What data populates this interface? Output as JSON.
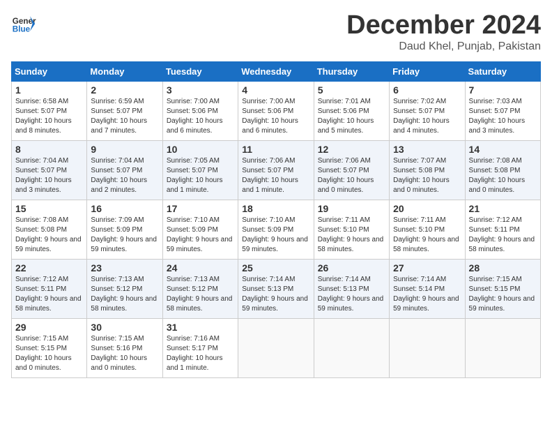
{
  "header": {
    "logo_line1": "General",
    "logo_line2": "Blue",
    "month": "December 2024",
    "location": "Daud Khel, Punjab, Pakistan"
  },
  "weekdays": [
    "Sunday",
    "Monday",
    "Tuesday",
    "Wednesday",
    "Thursday",
    "Friday",
    "Saturday"
  ],
  "weeks": [
    [
      {
        "day": 1,
        "sunrise": "6:58 AM",
        "sunset": "5:07 PM",
        "daylight": "10 hours and 8 minutes."
      },
      {
        "day": 2,
        "sunrise": "6:59 AM",
        "sunset": "5:07 PM",
        "daylight": "10 hours and 7 minutes."
      },
      {
        "day": 3,
        "sunrise": "7:00 AM",
        "sunset": "5:06 PM",
        "daylight": "10 hours and 6 minutes."
      },
      {
        "day": 4,
        "sunrise": "7:00 AM",
        "sunset": "5:06 PM",
        "daylight": "10 hours and 6 minutes."
      },
      {
        "day": 5,
        "sunrise": "7:01 AM",
        "sunset": "5:06 PM",
        "daylight": "10 hours and 5 minutes."
      },
      {
        "day": 6,
        "sunrise": "7:02 AM",
        "sunset": "5:07 PM",
        "daylight": "10 hours and 4 minutes."
      },
      {
        "day": 7,
        "sunrise": "7:03 AM",
        "sunset": "5:07 PM",
        "daylight": "10 hours and 3 minutes."
      }
    ],
    [
      {
        "day": 8,
        "sunrise": "7:04 AM",
        "sunset": "5:07 PM",
        "daylight": "10 hours and 3 minutes."
      },
      {
        "day": 9,
        "sunrise": "7:04 AM",
        "sunset": "5:07 PM",
        "daylight": "10 hours and 2 minutes."
      },
      {
        "day": 10,
        "sunrise": "7:05 AM",
        "sunset": "5:07 PM",
        "daylight": "10 hours and 1 minute."
      },
      {
        "day": 11,
        "sunrise": "7:06 AM",
        "sunset": "5:07 PM",
        "daylight": "10 hours and 1 minute."
      },
      {
        "day": 12,
        "sunrise": "7:06 AM",
        "sunset": "5:07 PM",
        "daylight": "10 hours and 0 minutes."
      },
      {
        "day": 13,
        "sunrise": "7:07 AM",
        "sunset": "5:08 PM",
        "daylight": "10 hours and 0 minutes."
      },
      {
        "day": 14,
        "sunrise": "7:08 AM",
        "sunset": "5:08 PM",
        "daylight": "10 hours and 0 minutes."
      }
    ],
    [
      {
        "day": 15,
        "sunrise": "7:08 AM",
        "sunset": "5:08 PM",
        "daylight": "9 hours and 59 minutes."
      },
      {
        "day": 16,
        "sunrise": "7:09 AM",
        "sunset": "5:09 PM",
        "daylight": "9 hours and 59 minutes."
      },
      {
        "day": 17,
        "sunrise": "7:10 AM",
        "sunset": "5:09 PM",
        "daylight": "9 hours and 59 minutes."
      },
      {
        "day": 18,
        "sunrise": "7:10 AM",
        "sunset": "5:09 PM",
        "daylight": "9 hours and 59 minutes."
      },
      {
        "day": 19,
        "sunrise": "7:11 AM",
        "sunset": "5:10 PM",
        "daylight": "9 hours and 58 minutes."
      },
      {
        "day": 20,
        "sunrise": "7:11 AM",
        "sunset": "5:10 PM",
        "daylight": "9 hours and 58 minutes."
      },
      {
        "day": 21,
        "sunrise": "7:12 AM",
        "sunset": "5:11 PM",
        "daylight": "9 hours and 58 minutes."
      }
    ],
    [
      {
        "day": 22,
        "sunrise": "7:12 AM",
        "sunset": "5:11 PM",
        "daylight": "9 hours and 58 minutes."
      },
      {
        "day": 23,
        "sunrise": "7:13 AM",
        "sunset": "5:12 PM",
        "daylight": "9 hours and 58 minutes."
      },
      {
        "day": 24,
        "sunrise": "7:13 AM",
        "sunset": "5:12 PM",
        "daylight": "9 hours and 58 minutes."
      },
      {
        "day": 25,
        "sunrise": "7:14 AM",
        "sunset": "5:13 PM",
        "daylight": "9 hours and 59 minutes."
      },
      {
        "day": 26,
        "sunrise": "7:14 AM",
        "sunset": "5:13 PM",
        "daylight": "9 hours and 59 minutes."
      },
      {
        "day": 27,
        "sunrise": "7:14 AM",
        "sunset": "5:14 PM",
        "daylight": "9 hours and 59 minutes."
      },
      {
        "day": 28,
        "sunrise": "7:15 AM",
        "sunset": "5:15 PM",
        "daylight": "9 hours and 59 minutes."
      }
    ],
    [
      {
        "day": 29,
        "sunrise": "7:15 AM",
        "sunset": "5:15 PM",
        "daylight": "10 hours and 0 minutes."
      },
      {
        "day": 30,
        "sunrise": "7:15 AM",
        "sunset": "5:16 PM",
        "daylight": "10 hours and 0 minutes."
      },
      {
        "day": 31,
        "sunrise": "7:16 AM",
        "sunset": "5:17 PM",
        "daylight": "10 hours and 1 minute."
      },
      null,
      null,
      null,
      null
    ]
  ]
}
